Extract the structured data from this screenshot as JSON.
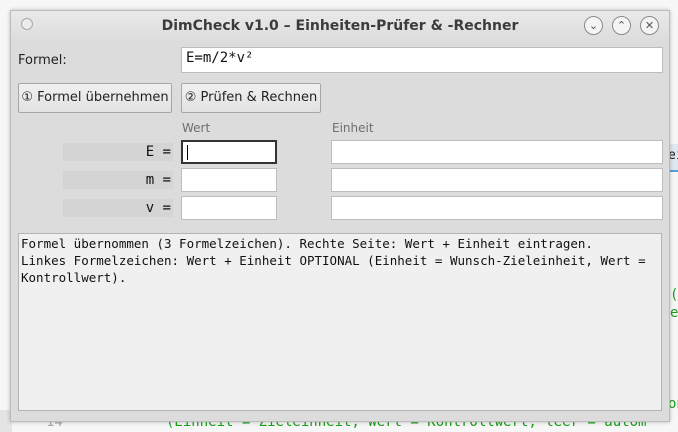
{
  "window": {
    "title": "DimCheck v1.0 – Einheiten-Prüfer & -Rechner"
  },
  "formula": {
    "label": "Formel:",
    "value": "E=m/2*v²"
  },
  "buttons": {
    "apply_formula": "① Formel übernehmen",
    "check_compute": "② Prüfen & Rechnen"
  },
  "columns": {
    "value": "Wert",
    "unit": "Einheit"
  },
  "variables": [
    {
      "label": "E =",
      "value": "",
      "unit": ""
    },
    {
      "label": "m =",
      "value": "",
      "unit": ""
    },
    {
      "label": "v =",
      "value": "",
      "unit": ""
    }
  ],
  "output": {
    "text": "Formel übernommen (3 Formelzeichen). Rechte Seite: Wert + Einheit eintragen.\nLinkes Formelzeichen: Wert + Einheit OPTIONAL (Einheit = Wunsch-Zieleinheit, Wert = Kontrollwert)."
  },
  "background_editor": {
    "tab_fragment": "ei",
    "code_fragment_1": "(",
    "code_fragment_2": "e",
    "code_fragment_3": "on",
    "bottom_code_line": "(Einheit = Zieleinheit, Wert = Kontrollwert, leer = autom",
    "line_number": "14"
  },
  "colors": {
    "dialog_bg": "#dcdcdc",
    "code_green": "#1aa01a",
    "tab_accent": "#5a9fd8"
  }
}
